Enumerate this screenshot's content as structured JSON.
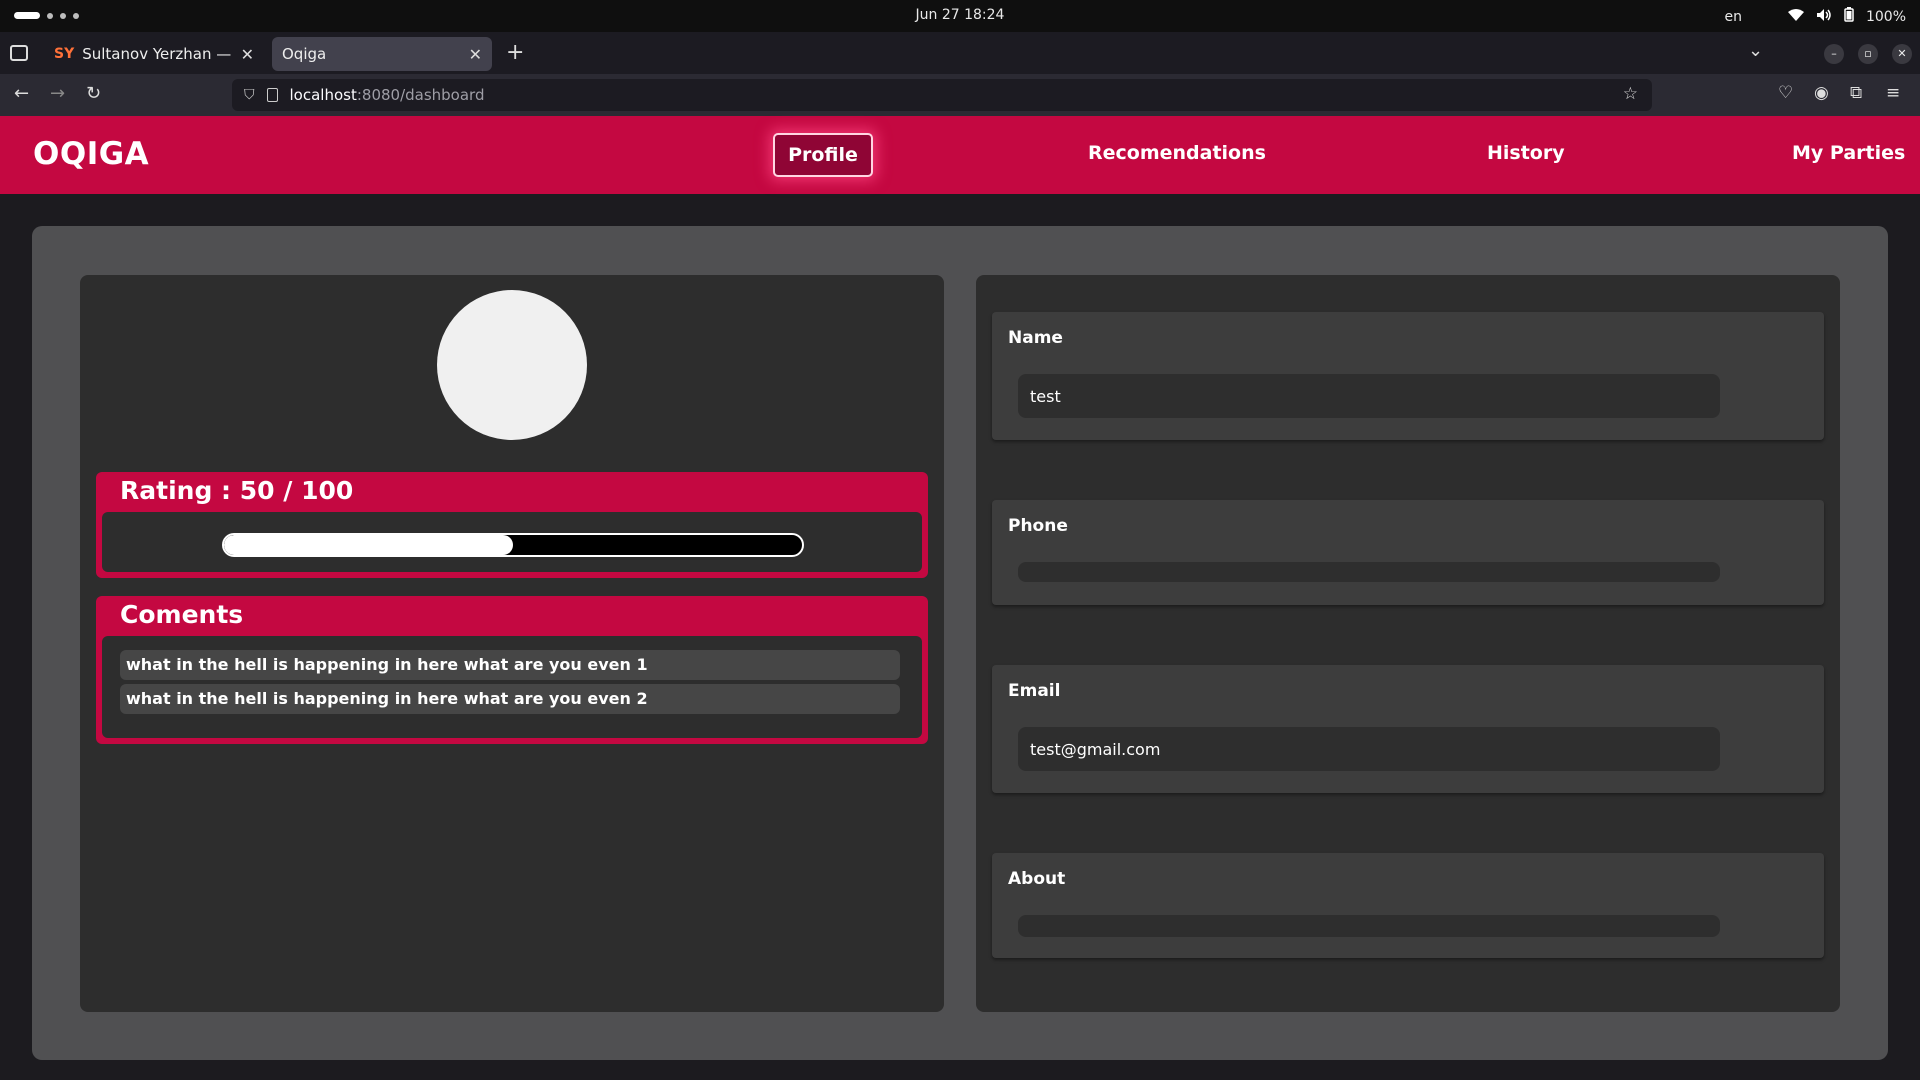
{
  "os": {
    "clock": "Jun 27  18:24",
    "lang": "en",
    "battery": "100%"
  },
  "browser": {
    "tabs": [
      {
        "favicon": "SY",
        "title": "Sultanov Yerzhan — Deve"
      },
      {
        "title": "Oqiga"
      }
    ],
    "url_host": "localhost",
    "url_path": ":8080/dashboard"
  },
  "app": {
    "brand": "OQIGA",
    "nav": {
      "profile": "Profile",
      "recommendations": "Recomendations",
      "history": "History",
      "parties": "My Parties"
    }
  },
  "profile": {
    "rating_title": "Rating : 50 / 100",
    "rating_value": 50,
    "rating_max": 100,
    "comments_title": "Coments",
    "comments": [
      "what in the hell is happening in here what are you even 1",
      "what in the hell is happening in here what are you even 2"
    ],
    "fields": {
      "name_label": "Name",
      "name_value": "test",
      "phone_label": "Phone",
      "phone_value": "",
      "email_label": "Email",
      "email_value": "test@gmail.com",
      "about_label": "About",
      "about_value": ""
    }
  },
  "colors": {
    "accent": "#c40841",
    "panel": "#505052",
    "card": "#2d2d2d"
  }
}
